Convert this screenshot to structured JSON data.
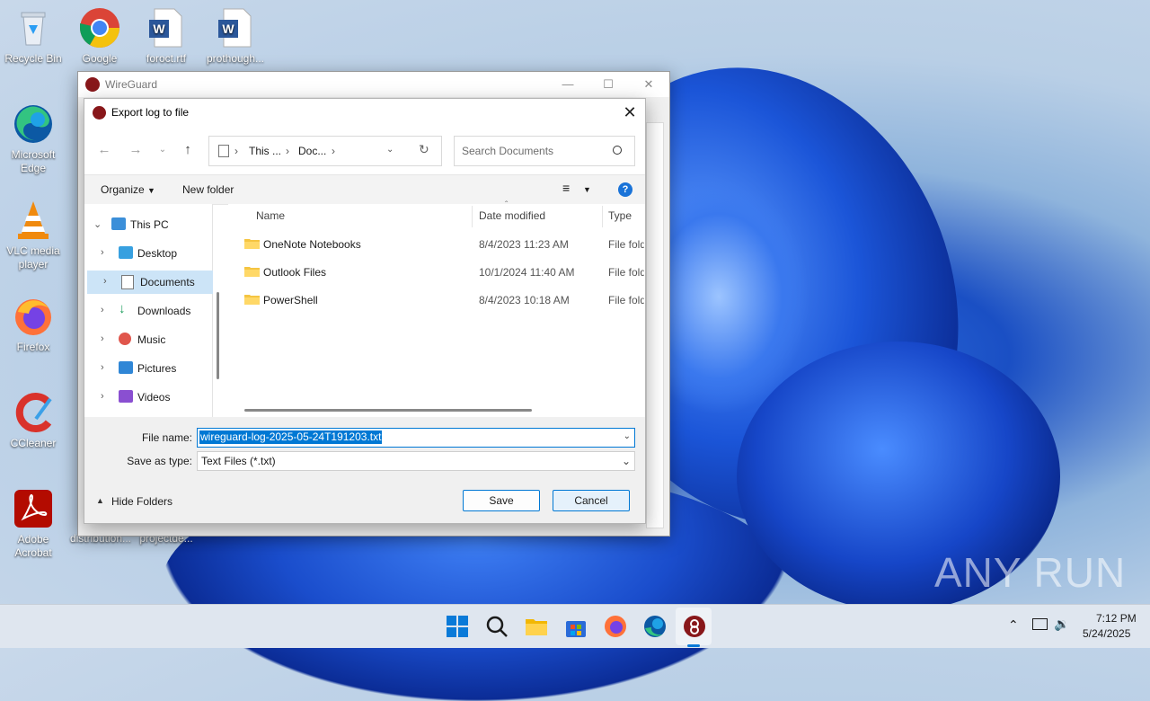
{
  "desktop": {
    "icons": [
      {
        "label": "Recycle Bin"
      },
      {
        "label": "Google Chrome"
      },
      {
        "label": "foroct.rtf"
      },
      {
        "label": "prothough..."
      },
      {
        "label": "Microsoft Edge"
      },
      {
        "label": "VLC media player"
      },
      {
        "label": "Firefox"
      },
      {
        "label": "CCleaner"
      },
      {
        "label": "Adobe Acrobat"
      },
      {
        "label": "distribution..."
      },
      {
        "label": "projectde..."
      }
    ],
    "watermark": "ANY RUN"
  },
  "parent_window": {
    "title": "WireGuard"
  },
  "dialog": {
    "title": "Export log to file",
    "breadcrumb": [
      "This ...",
      "Doc..."
    ],
    "search_placeholder": "Search Documents",
    "toolbar": {
      "organize": "Organize",
      "new_folder": "New folder"
    },
    "nav": [
      {
        "label": "This PC"
      },
      {
        "label": "Desktop"
      },
      {
        "label": "Documents"
      },
      {
        "label": "Downloads"
      },
      {
        "label": "Music"
      },
      {
        "label": "Pictures"
      },
      {
        "label": "Videos"
      }
    ],
    "columns": {
      "name": "Name",
      "date": "Date modified",
      "type": "Type"
    },
    "files": [
      {
        "name": "OneNote Notebooks",
        "date": "8/4/2023 11:23 AM",
        "type": "File fold"
      },
      {
        "name": "Outlook Files",
        "date": "10/1/2024 11:40 AM",
        "type": "File fold"
      },
      {
        "name": "PowerShell",
        "date": "8/4/2023 10:18 AM",
        "type": "File fold"
      }
    ],
    "file_name_label": "File name:",
    "file_name_value": "wireguard-log-2025-05-24T191203.txt",
    "save_type_label": "Save as type:",
    "save_type_value": "Text Files (*.txt)",
    "hide_folders": "Hide Folders",
    "save_button": "Save",
    "cancel_button": "Cancel"
  },
  "taskbar": {
    "time": "7:12 PM",
    "date": "5/24/2025"
  },
  "colors": {
    "accent": "#0078d4",
    "selection": "#cce4f7"
  }
}
